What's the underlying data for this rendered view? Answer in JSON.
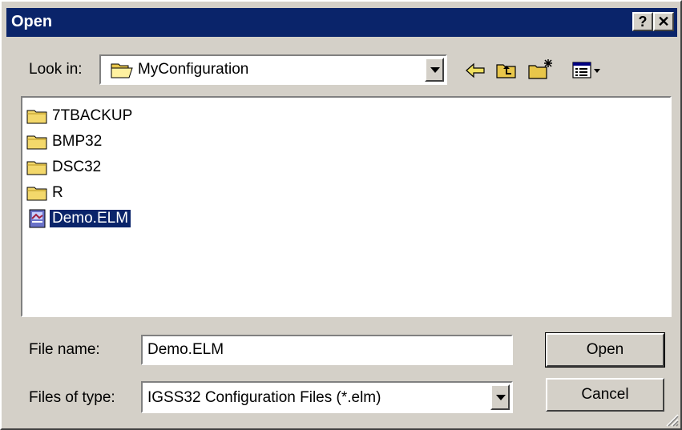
{
  "window": {
    "title": "Open",
    "help_button": "?",
    "close_button": "✕"
  },
  "look_in": {
    "label": "Look in:",
    "value": "MyConfiguration"
  },
  "files": [
    {
      "name": "7TBACKUP",
      "type": "folder"
    },
    {
      "name": "BMP32",
      "type": "folder"
    },
    {
      "name": "DSC32",
      "type": "folder"
    },
    {
      "name": "R",
      "type": "folder"
    },
    {
      "name": "Demo.ELM",
      "type": "file",
      "selected": true
    }
  ],
  "file_name": {
    "label": "File name:",
    "value": "Demo.ELM"
  },
  "file_type": {
    "label": "Files of type:",
    "value": "IGSS32 Configuration Files (*.elm)"
  },
  "buttons": {
    "open": "Open",
    "cancel": "Cancel"
  },
  "icons": {
    "folder": "folder-icon",
    "file": "elm-file-icon",
    "back": "back-arrow-icon",
    "up": "up-folder-icon",
    "new_folder": "new-folder-icon",
    "view": "view-menu-icon"
  },
  "colors": {
    "title_bar": "#0a246a",
    "dialog_bg": "#d4d0c8",
    "selection": "#0a246a"
  }
}
